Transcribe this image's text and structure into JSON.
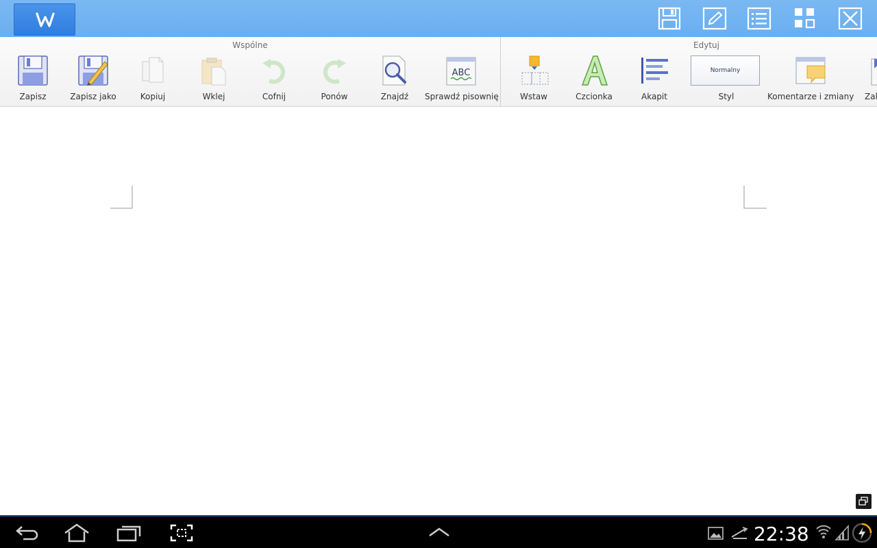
{
  "titlebar": {
    "logo_letter": "W",
    "actions": [
      {
        "name": "save-icon"
      },
      {
        "name": "edit-icon"
      },
      {
        "name": "list-icon"
      },
      {
        "name": "grid-icon"
      },
      {
        "name": "close-icon"
      }
    ]
  },
  "ribbon": {
    "groups": [
      {
        "title": "Wspólne"
      },
      {
        "title": "Edytuj"
      }
    ],
    "items": [
      {
        "label": "Zapisz"
      },
      {
        "label": "Zapisz jako"
      },
      {
        "label": "Kopiuj"
      },
      {
        "label": "Wklej"
      },
      {
        "label": "Cofnij"
      },
      {
        "label": "Ponów"
      },
      {
        "label": "Znajdź"
      },
      {
        "label": "Sprawdź pisownię"
      },
      {
        "label": "Wstaw"
      },
      {
        "label": "Czcionka"
      },
      {
        "label": "Akapit"
      },
      {
        "label": "Styl"
      },
      {
        "label": "Komentarze i zmiany"
      },
      {
        "label": "Zak"
      }
    ],
    "style_value": "Normalny",
    "spell_icon_text": "ABC"
  },
  "statusbar": {
    "clock": "22:38"
  },
  "colors": {
    "titlebar": "#6aaef0",
    "accent": "#2f7de0",
    "ribbon_bg": "#f4f4f4",
    "system_bar": "#000000"
  }
}
